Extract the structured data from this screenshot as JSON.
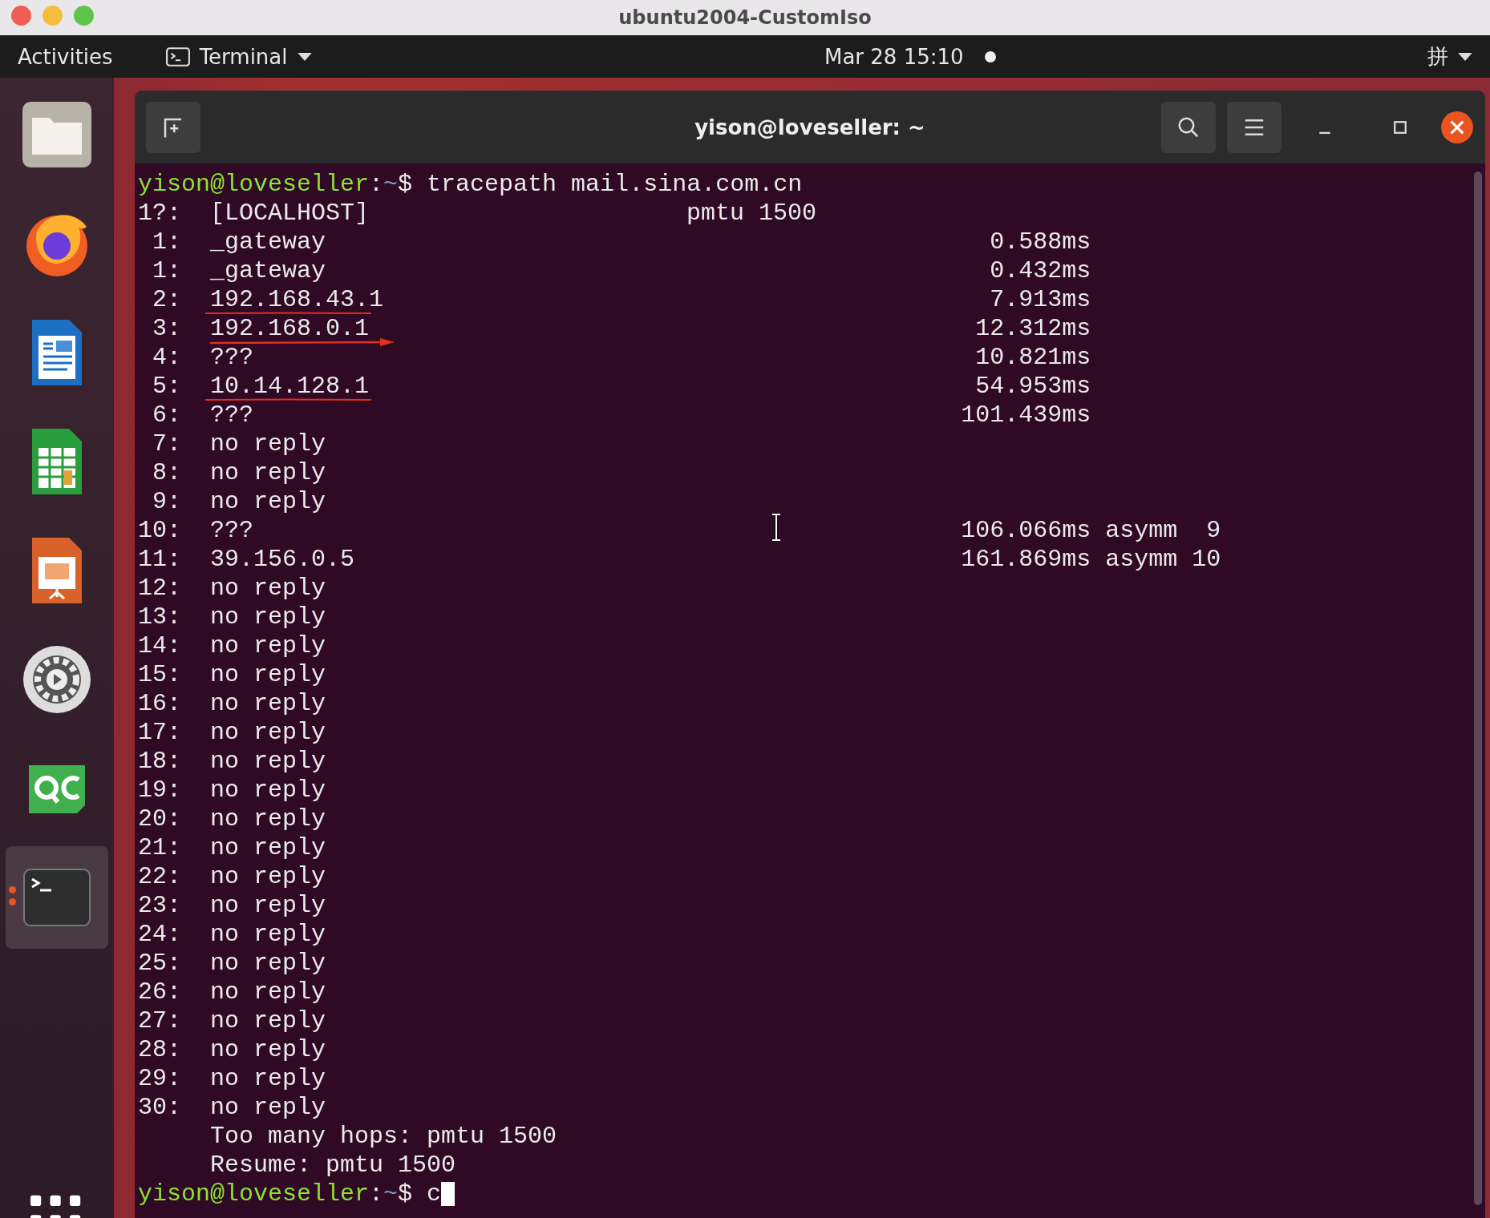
{
  "window": {
    "title": "ubuntu2004-CustomIso"
  },
  "top_bar": {
    "activities": "Activities",
    "app": "Terminal",
    "clock": "Mar 28  15:10",
    "input_method": "拼"
  },
  "dock": {
    "items": [
      {
        "kind": "files",
        "active": false
      },
      {
        "kind": "browser",
        "active": false
      },
      {
        "kind": "writer",
        "active": false
      },
      {
        "kind": "calc",
        "active": false
      },
      {
        "kind": "impress",
        "active": false
      },
      {
        "kind": "settings",
        "active": false
      },
      {
        "kind": "qc",
        "active": false
      },
      {
        "kind": "terminal",
        "active": true
      }
    ]
  },
  "terminal": {
    "title": "yison@loveseller: ~",
    "command": {
      "user": "yison@loveseller",
      "sep": ":",
      "path": "~",
      "prompt": "$",
      "text": "tracepath mail.sina.com.cn"
    },
    "rows": [
      {
        "hop": "1?:",
        "host": "[LOCALHOST]",
        "pmtu": "pmtu 1500",
        "underlined": false,
        "arrowed": false
      },
      {
        "hop": "1:",
        "host": "_gateway",
        "time": "0.588ms",
        "underlined": false,
        "arrowed": false
      },
      {
        "hop": "1:",
        "host": "_gateway",
        "time": "0.432ms",
        "underlined": false,
        "arrowed": false
      },
      {
        "hop": "2:",
        "host": "192.168.43.1",
        "time": "7.913ms",
        "underlined": true,
        "arrowed": false
      },
      {
        "hop": "3:",
        "host": "192.168.0.1",
        "time": "12.312ms",
        "underlined": false,
        "arrowed": true
      },
      {
        "hop": "4:",
        "host": "???",
        "time": "10.821ms",
        "underlined": false,
        "arrowed": false
      },
      {
        "hop": "5:",
        "host": "10.14.128.1",
        "time": "54.953ms",
        "underlined": true,
        "arrowed": false
      },
      {
        "hop": "6:",
        "host": "???",
        "time": "101.439ms",
        "underlined": false,
        "arrowed": false
      },
      {
        "hop": "7:",
        "host": "no reply"
      },
      {
        "hop": "8:",
        "host": "no reply"
      },
      {
        "hop": "9:",
        "host": "no reply"
      },
      {
        "hop": "10:",
        "host": "???",
        "time": "106.066ms",
        "extra": "asymm  9"
      },
      {
        "hop": "11:",
        "host": "39.156.0.5",
        "time": "161.869ms",
        "extra": "asymm 10"
      },
      {
        "hop": "12:",
        "host": "no reply"
      },
      {
        "hop": "13:",
        "host": "no reply"
      },
      {
        "hop": "14:",
        "host": "no reply"
      },
      {
        "hop": "15:",
        "host": "no reply"
      },
      {
        "hop": "16:",
        "host": "no reply"
      },
      {
        "hop": "17:",
        "host": "no reply"
      },
      {
        "hop": "18:",
        "host": "no reply"
      },
      {
        "hop": "19:",
        "host": "no reply"
      },
      {
        "hop": "20:",
        "host": "no reply"
      },
      {
        "hop": "21:",
        "host": "no reply"
      },
      {
        "hop": "22:",
        "host": "no reply"
      },
      {
        "hop": "23:",
        "host": "no reply"
      },
      {
        "hop": "24:",
        "host": "no reply"
      },
      {
        "hop": "25:",
        "host": "no reply"
      },
      {
        "hop": "26:",
        "host": "no reply"
      },
      {
        "hop": "27:",
        "host": "no reply"
      },
      {
        "hop": "28:",
        "host": "no reply"
      },
      {
        "hop": "29:",
        "host": "no reply"
      },
      {
        "hop": "30:",
        "host": "no reply"
      }
    ],
    "summary": [
      "Too many hops: pmtu 1500",
      "Resume: pmtu 1500"
    ],
    "final_prompt": {
      "user": "yison@loveseller",
      "sep": ":",
      "path": "~",
      "prompt": "$",
      "text": "c"
    }
  }
}
